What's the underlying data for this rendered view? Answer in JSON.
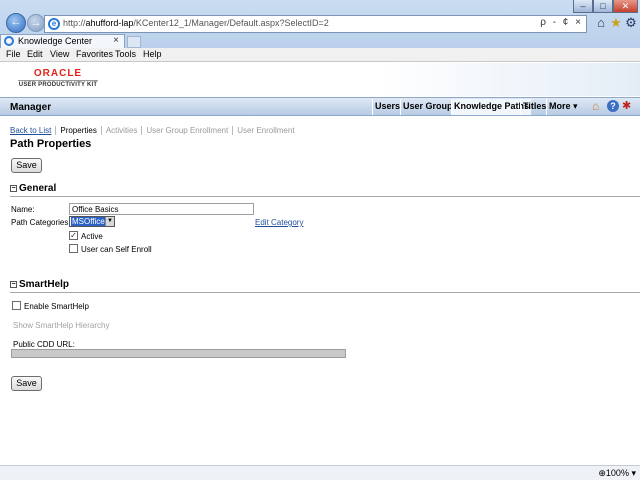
{
  "browser": {
    "url_prefix": "http://",
    "url_host": "ahufford-lap",
    "url_path": "/KCenter12_1/Manager/Default.aspx?SelectID=2",
    "address_tools": "ρ - ¢ ×",
    "tab_title": "Knowledge Center",
    "tab_close": "×",
    "menu": [
      "File",
      "Edit",
      "View",
      "Favorites",
      "Tools",
      "Help"
    ],
    "zoom": "100%",
    "zoom_icon": "⊕",
    "zoom_arrow": "▾",
    "window_controls": {
      "minimize": "–",
      "maximize": "□",
      "close": "✕"
    },
    "icons": {
      "back": "back-arrow-icon",
      "forward": "forward-arrow-icon",
      "home": "home-icon",
      "favorites": "star-icon",
      "tools": "gear-icon"
    }
  },
  "branding": {
    "logo_word": "ORACLE",
    "logo_sub": "USER PRODUCTIVITY KIT",
    "logo_color": "#e2231a"
  },
  "header": {
    "title": "Manager",
    "nav": [
      "Users",
      "User Groups",
      "Knowledge Paths",
      "Titles",
      "More ▾"
    ],
    "active_nav": "Knowledge Paths"
  },
  "subnav": {
    "back": "Back to List",
    "properties": "Properties",
    "activities": "Activities",
    "user_group_enrollment": "User Group Enrollment",
    "user_enrollment": "User Enrollment"
  },
  "page": {
    "title": "Path Properties",
    "save_label": "Save"
  },
  "general": {
    "heading": "General",
    "toggle": "⊟",
    "name_label": "Name:",
    "name_value": "Office Basics",
    "categories_label": "Path Categories:",
    "category_value": "MSOffice",
    "edit_category": "Edit Category",
    "active_label": "Active",
    "active_checked": true,
    "self_enroll_label": "User can Self Enroll",
    "self_enroll_checked": false
  },
  "smarthelp": {
    "heading": "SmartHelp",
    "toggle": "⊟",
    "enable_label": "Enable SmartHelp",
    "enable_checked": false,
    "hierarchy_link": "Show SmartHelp Hierarchy",
    "cdd_label": "Public CDD URL:",
    "cdd_value": ""
  }
}
